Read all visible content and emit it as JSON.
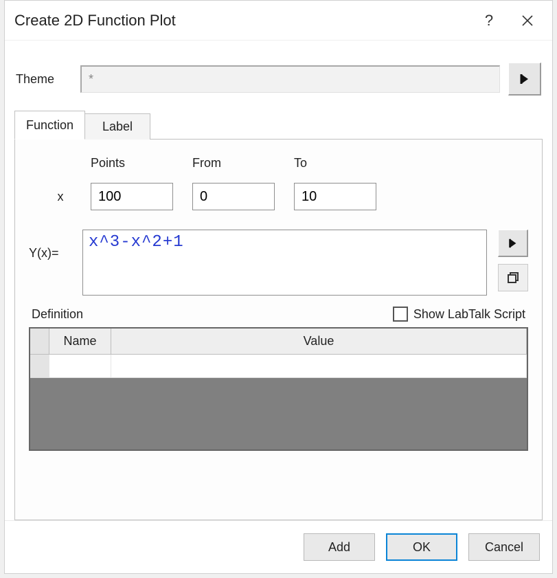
{
  "dialog": {
    "title": "Create 2D Function Plot",
    "help_glyph": "?",
    "close_glyph": "✕"
  },
  "theme": {
    "label": "Theme",
    "value": "*"
  },
  "tabs": {
    "items": [
      "Function",
      "Label"
    ],
    "active": 0
  },
  "function_tab": {
    "headers": {
      "points": "Points",
      "from": "From",
      "to": "To"
    },
    "x_row": {
      "label": "x",
      "points": "100",
      "from": "0",
      "to": "10"
    },
    "y_row": {
      "label": "Y(x)=",
      "expression": "x^3-x^2+1"
    },
    "definition_label": "Definition",
    "show_labtalk": {
      "label": "Show LabTalk Script",
      "checked": false
    },
    "grid": {
      "columns": [
        "",
        "Name",
        "Value"
      ],
      "rows": [
        {
          "name": "",
          "value": ""
        }
      ]
    }
  },
  "buttons": {
    "add": "Add",
    "ok": "OK",
    "cancel": "Cancel"
  },
  "icons": {
    "play": "▶",
    "show_window": "❐"
  }
}
